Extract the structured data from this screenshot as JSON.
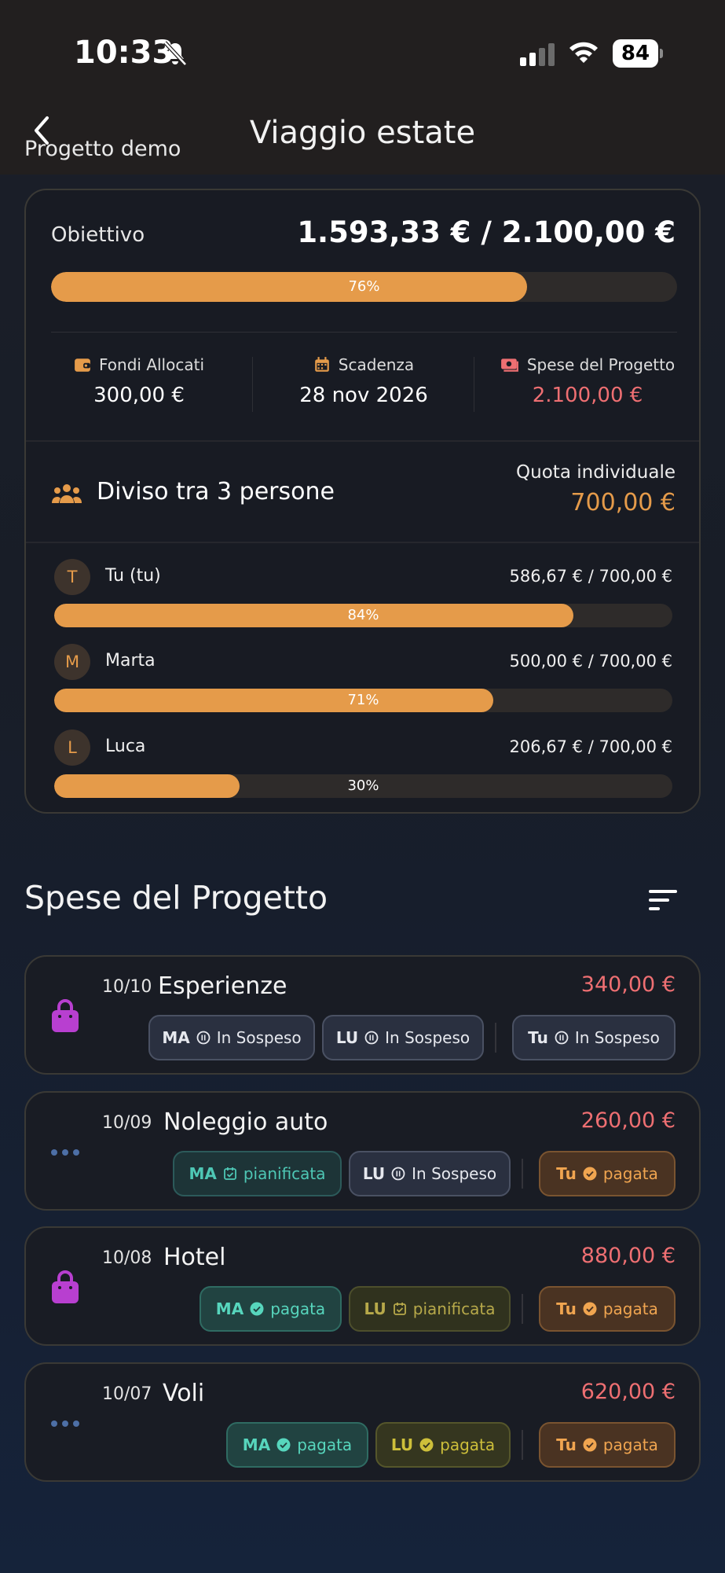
{
  "status_bar": {
    "time": "10:33",
    "battery": "84"
  },
  "nav": {
    "back_label": "Progetto demo",
    "title": "Viaggio estate"
  },
  "summary": {
    "goal_label": "Obiettivo",
    "goal_amount": "1.593,33 € / 2.100,00 €",
    "goal_progress_percent": 76,
    "goal_progress_label": "76%",
    "stats": [
      {
        "label": "Fondi Allocati",
        "value": "300,00 €",
        "icon": "wallet-icon"
      },
      {
        "label": "Scadenza",
        "value": "28 nov 2026",
        "icon": "calendar-icon"
      },
      {
        "label": "Spese del Progetto",
        "value": "2.100,00 €",
        "icon": "money-icon"
      }
    ],
    "split_text": "Diviso tra 3 persone",
    "quota_label": "Quota individuale",
    "quota_value": "700,00 €",
    "members": [
      {
        "initial": "T",
        "name": "Tu (tu)",
        "amount": "586,67 € / 700,00 €",
        "percent": 84,
        "percent_label": "84%"
      },
      {
        "initial": "M",
        "name": "Marta",
        "amount": "500,00 € / 700,00 €",
        "percent": 71,
        "percent_label": "71%"
      },
      {
        "initial": "L",
        "name": "Luca",
        "amount": "206,67 € / 700,00 €",
        "percent": 30,
        "percent_label": "30%"
      }
    ]
  },
  "expenses_section": {
    "title": "Spese del Progetto"
  },
  "expenses": [
    {
      "date": "10/10",
      "name": "Esperienze",
      "amount": "340,00 €",
      "icon": "shopping-bag-icon",
      "chips": [
        {
          "who": "MA",
          "status": "In Sospeso"
        },
        {
          "who": "LU",
          "status": "In Sospeso"
        },
        {
          "who": "Tu",
          "status": "In Sospeso"
        }
      ]
    },
    {
      "date": "10/09",
      "name": "Noleggio auto",
      "amount": "260,00 €",
      "icon": "more-dots-icon",
      "chips": [
        {
          "who": "MA",
          "status": "pianificata"
        },
        {
          "who": "LU",
          "status": "In Sospeso"
        },
        {
          "who": "Tu",
          "status": "pagata"
        }
      ]
    },
    {
      "date": "10/08",
      "name": "Hotel",
      "amount": "880,00 €",
      "icon": "shopping-bag-icon",
      "chips": [
        {
          "who": "MA",
          "status": "pagata"
        },
        {
          "who": "LU",
          "status": "pianificata"
        },
        {
          "who": "Tu",
          "status": "pagata"
        }
      ]
    },
    {
      "date": "10/07",
      "name": "Voli",
      "amount": "620,00 €",
      "icon": "more-dots-icon",
      "chips": [
        {
          "who": "MA",
          "status": "pagata"
        },
        {
          "who": "LU",
          "status": "pagata"
        },
        {
          "who": "Tu",
          "status": "pagata"
        }
      ]
    }
  ]
}
